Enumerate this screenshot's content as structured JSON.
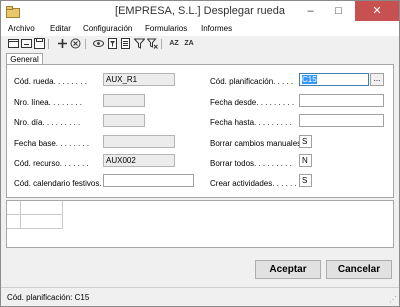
{
  "window": {
    "title": "[EMPRESA, S.L.] Desplegar rueda",
    "minimize": "–",
    "maximize": "□",
    "close": "✕"
  },
  "menu": [
    "Archivo",
    "Editar",
    "Configuración",
    "Formularios",
    "Informes"
  ],
  "toolbar": {
    "icons": [
      "new-record-icon",
      "delete-record-icon",
      "add-icon",
      "cancel-icon",
      "view-icon",
      "filter-form-icon",
      "filter-icon",
      "clear-filter-icon",
      "sort-az-icon",
      "sort-za-icon"
    ],
    "sort_az": "AZ",
    "sort_za": "ZA"
  },
  "tabs": [
    "General"
  ],
  "form": {
    "cod_rueda": {
      "label": "Cód. rueda. . . . . . . .",
      "value": "AUX_R1"
    },
    "nro_linea": {
      "label": "Nro. línea. . . . . . . .",
      "value": ""
    },
    "nro_dia": {
      "label": "Nro. día. . . . . . . . .",
      "value": ""
    },
    "fecha_base": {
      "label": "Fecha base. . . . . . . .",
      "value": ""
    },
    "cod_recurso": {
      "label": "Cód. recurso. . . . . . .",
      "value": "AUX002"
    },
    "cod_calendario": {
      "label": "Cód. calendario festivos.",
      "value": ""
    },
    "cod_planificacion": {
      "label": "Cód. planificación. . . . .",
      "value": "C15",
      "lookup": "..."
    },
    "fecha_desde": {
      "label": "Fecha desde. . . . . . . . .",
      "value": ""
    },
    "fecha_hasta": {
      "label": "Fecha hasta. . . . . . . . .",
      "value": ""
    },
    "borrar_cambios": {
      "label": "Borrar cambios manuales.",
      "value": "S"
    },
    "borrar_todos": {
      "label": "Borrar todos. . . . . . . . .",
      "value": "N"
    },
    "crear_actividades": {
      "label": "Crear actividades. . . . . .",
      "value": "S"
    }
  },
  "buttons": {
    "accept": "Aceptar",
    "cancel": "Cancelar"
  },
  "status": {
    "text": "Cód. planificación: C15"
  }
}
